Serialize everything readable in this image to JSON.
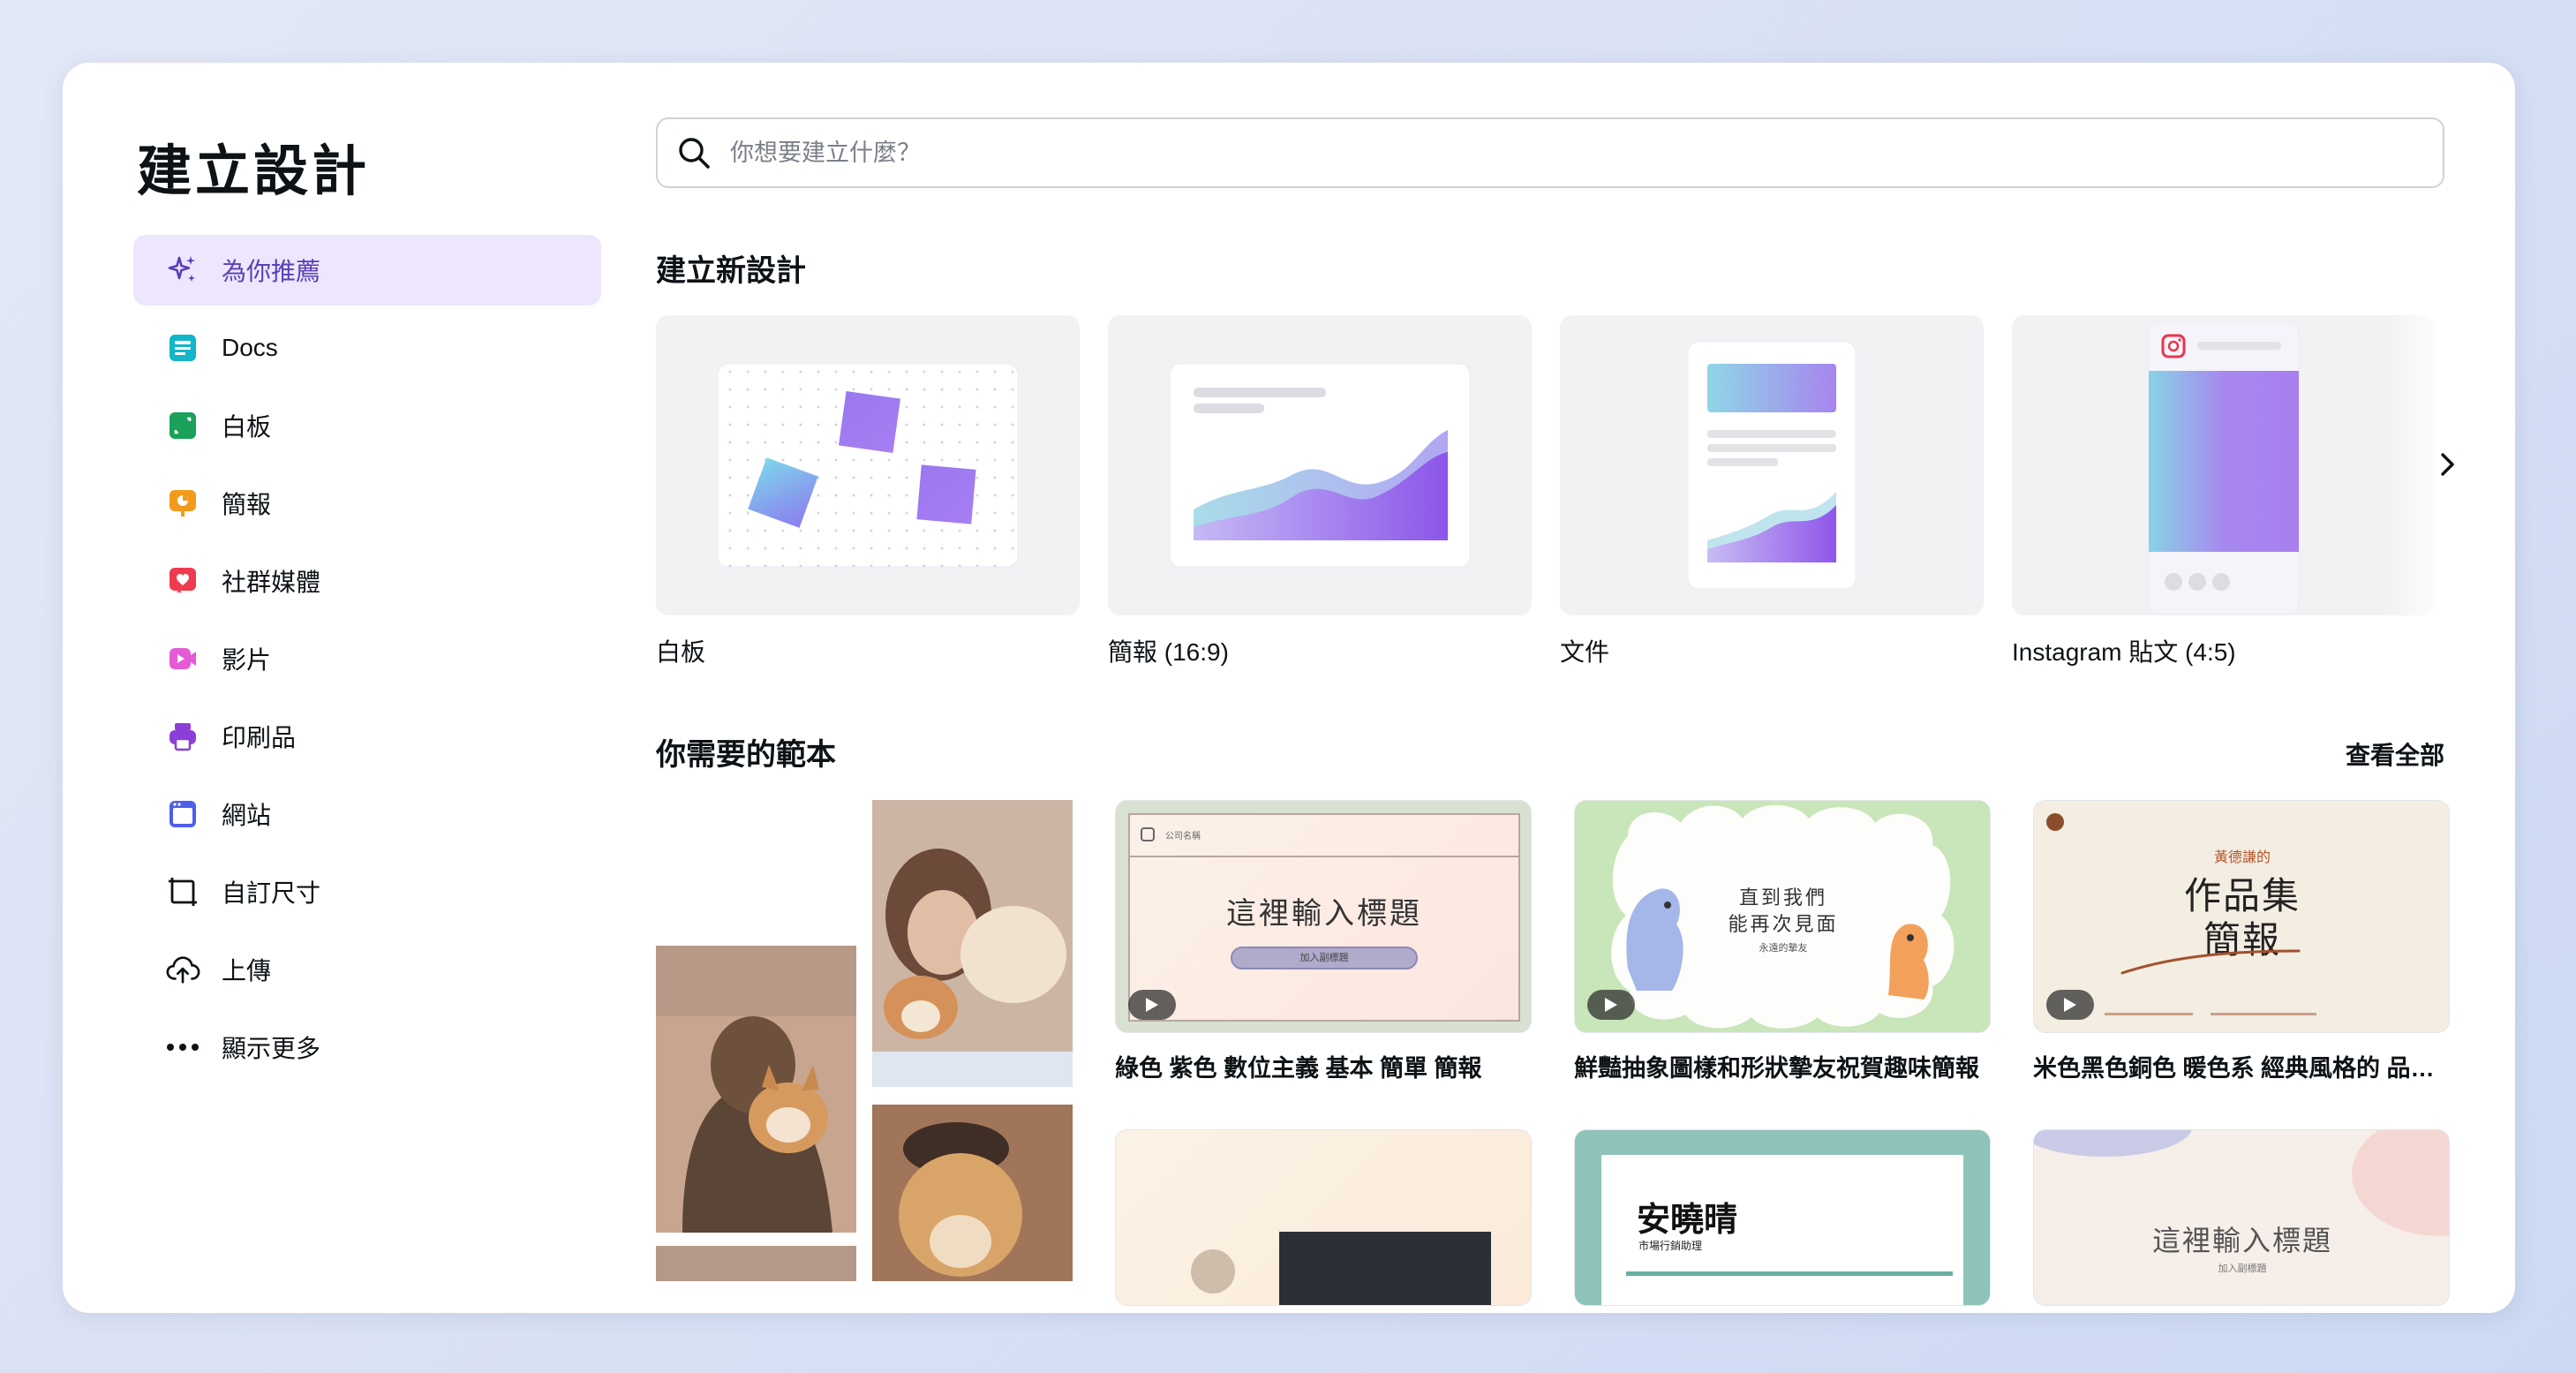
{
  "header": {
    "title": "建立設計"
  },
  "search": {
    "placeholder": "你想要建立什麼？"
  },
  "sidebar": {
    "items": [
      {
        "label": "為你推薦",
        "icon": "sparkle-icon",
        "active": true,
        "color": "#5a3fb8"
      },
      {
        "label": "Docs",
        "icon": "docs-icon",
        "color": "#13b5c8"
      },
      {
        "label": "白板",
        "icon": "whiteboard-icon",
        "color": "#1aa15a"
      },
      {
        "label": "簡報",
        "icon": "presentation-icon",
        "color": "#f39a1c"
      },
      {
        "label": "社群媒體",
        "icon": "heart-icon",
        "color": "#ef3b4f"
      },
      {
        "label": "影片",
        "icon": "video-icon",
        "color": "#e55bd6"
      },
      {
        "label": "印刷品",
        "icon": "printer-icon",
        "color": "#8b3fd8"
      },
      {
        "label": "網站",
        "icon": "website-icon",
        "color": "#4f5fe8"
      },
      {
        "label": "自訂尺寸",
        "icon": "custom-size-icon",
        "color": "#0d1216"
      },
      {
        "label": "上傳",
        "icon": "cloud-upload-icon",
        "color": "#0d1216"
      },
      {
        "label": "顯示更多",
        "icon": "more-icon",
        "color": "#0d1216"
      }
    ]
  },
  "create_section": {
    "title": "建立新設計",
    "cards": [
      {
        "label": "白板",
        "icon": "whiteboard-thumb"
      },
      {
        "label": "簡報 (16:9)",
        "icon": "presentation-thumb"
      },
      {
        "label": "文件",
        "icon": "document-thumb"
      },
      {
        "label": "Instagram 貼文 (4:5)",
        "icon": "instagram-post-thumb"
      }
    ]
  },
  "templates_section": {
    "title": "你需要的範本",
    "see_all": "查看全部",
    "items": [
      {
        "label": "綠色 紫色 數位主義 基本 簡單 簡報",
        "thumb_title": "這裡輸入標題",
        "thumb_button": "加入副標題",
        "thumb_brand": "公司名稱"
      },
      {
        "label": "鮮豔抽象圖樣和形狀摯友祝賀趣味簡報",
        "thumb_line1": "直到我們",
        "thumb_line2": "能再次見面",
        "thumb_sub": "永遠的摯友"
      },
      {
        "label": "米色黑色銅色 暖色系 經典風格的 品牌作品集簡報",
        "thumb_small": "黃德謙的",
        "thumb_line1": "作品集",
        "thumb_line2": "簡報"
      }
    ],
    "row2": [
      {
        "thumb_title": ""
      },
      {
        "thumb_name": "安曉晴",
        "thumb_role": "市場行銷助理"
      },
      {
        "thumb_title": "這裡輸入標題",
        "thumb_sub": "加入副標題"
      }
    ]
  },
  "colors": {
    "accent": "#7d2ae8",
    "active_bg": "#ede6fd"
  }
}
